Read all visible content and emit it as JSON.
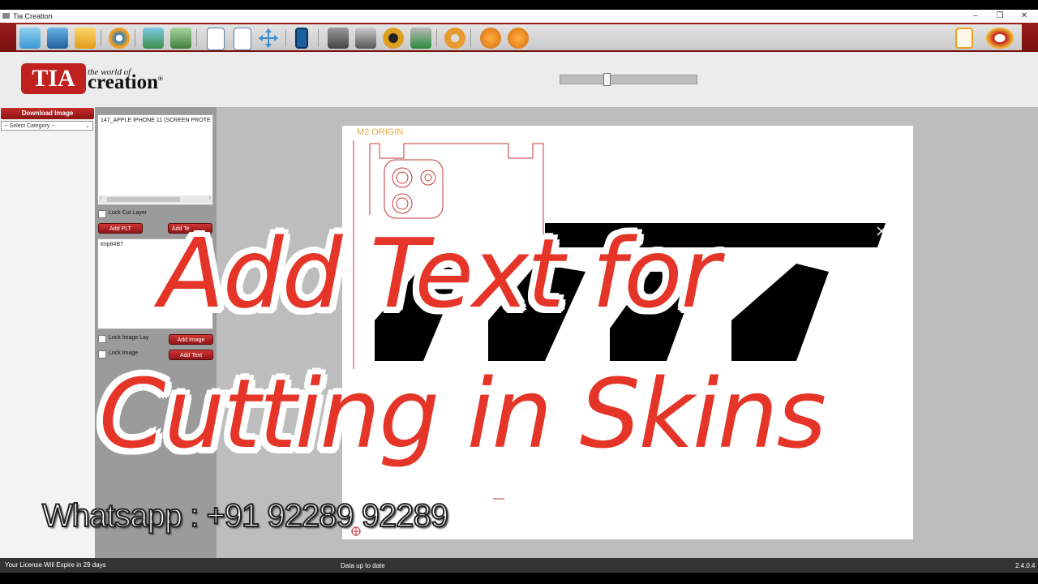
{
  "window": {
    "title": "Tia Creation",
    "controls": [
      "–",
      "❐",
      "✕"
    ]
  },
  "toolbar": {
    "icons": [
      "new-file-icon",
      "save-icon",
      "open-folder-icon",
      "settings-wheel-icon",
      "add-image-icon",
      "remove-image-icon",
      "page-a3-icon",
      "page-a4-icon",
      "move-arrows-icon",
      "phone-icon",
      "printer-icon",
      "plotter-icon",
      "pen-tool-icon",
      "cutter-icon",
      "gears-icon",
      "undo-icon",
      "redo-icon",
      "menu-icon",
      "machine-settings-icon"
    ]
  },
  "logo": {
    "mark": "TIA",
    "tagline": "the world of",
    "brand": "creation",
    "registered": "®"
  },
  "left_panel": {
    "download_button": "Download Image",
    "category_select": "-- Select Category --"
  },
  "mid_panel": {
    "plt_list": [
      "147_APPLE IPHONE 11 (SCREEN PROTE"
    ],
    "lock_cut_layer": "Lock Cut Layer",
    "add_plt": "Add PLT",
    "add_text_top": "Add Te",
    "image_list": [
      "tmp84B7"
    ],
    "lock_image_layer": "Lock Image Lay",
    "lock_image_2": "Lock Image",
    "add_image": "Add Image",
    "add_text": "Add Text"
  },
  "canvas": {
    "origin_label": "M2 ORIGIN"
  },
  "overlay": {
    "line1": "Add Text for",
    "line2": "Cutting in Skins",
    "contact": "Whatsapp : +91 92289 92289"
  },
  "status": {
    "license": "Your License Will Expire in 29 days",
    "data": "Data up to date",
    "version": "2.4.0.4"
  },
  "colors": {
    "brand_red": "#c0201e",
    "overlay_red": "#e53528",
    "origin_orange": "#e8a84a"
  }
}
